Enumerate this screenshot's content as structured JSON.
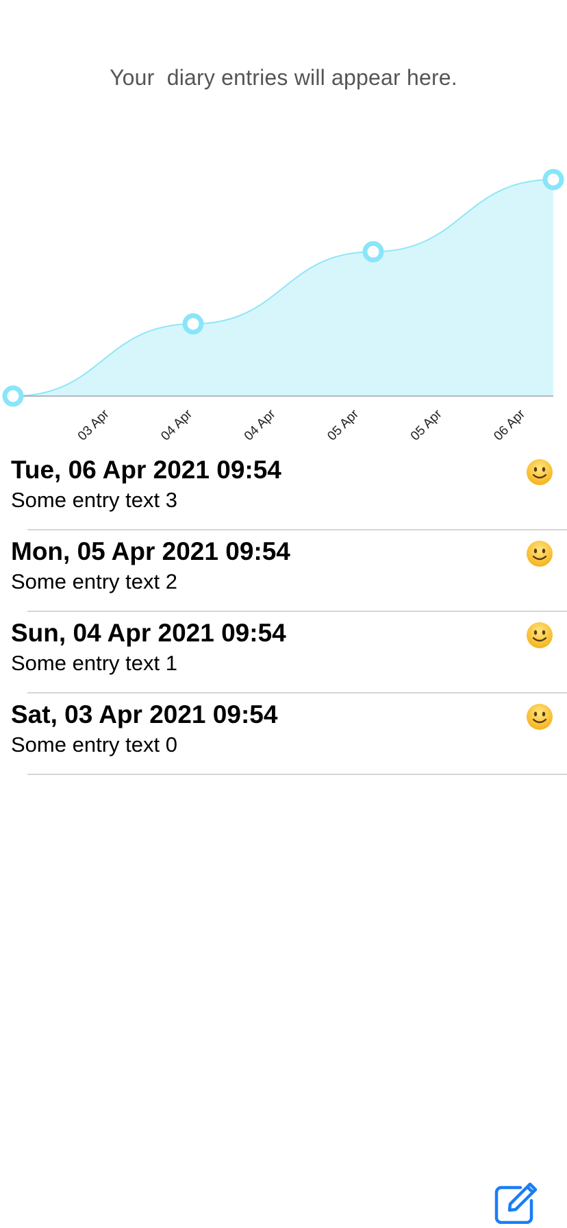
{
  "header": {
    "empty_message": "Your  diary entries will appear here."
  },
  "chart_data": {
    "type": "area",
    "categories": [
      "03 Apr",
      "04 Apr",
      "04 Apr",
      "05 Apr",
      "05 Apr",
      "06 Apr"
    ],
    "x": [
      "03 Apr",
      "04 Apr",
      "05 Apr",
      "06 Apr"
    ],
    "y": [
      0,
      1,
      2,
      3
    ],
    "ylim": [
      0,
      3
    ],
    "grid": false,
    "legend": "none",
    "colors": {
      "fill": "#d6f6fc",
      "line": "#8fe6f7",
      "point": "#89e5f9"
    }
  },
  "entries": [
    {
      "date": "Tue, 06 Apr 2021 09:54",
      "text": "Some entry text 3",
      "mood_icon": "slightly-smiling-face-icon"
    },
    {
      "date": "Mon, 05 Apr 2021 09:54",
      "text": "Some entry text 2",
      "mood_icon": "slightly-smiling-face-icon"
    },
    {
      "date": "Sun, 04 Apr 2021 09:54",
      "text": "Some entry text 1",
      "mood_icon": "slightly-smiling-face-icon"
    },
    {
      "date": "Sat, 03 Apr 2021 09:54",
      "text": "Some entry text 0",
      "mood_icon": "slightly-smiling-face-icon"
    }
  ],
  "toolbar": {
    "compose_icon": "compose-icon",
    "accent": "#1a7ef5"
  }
}
